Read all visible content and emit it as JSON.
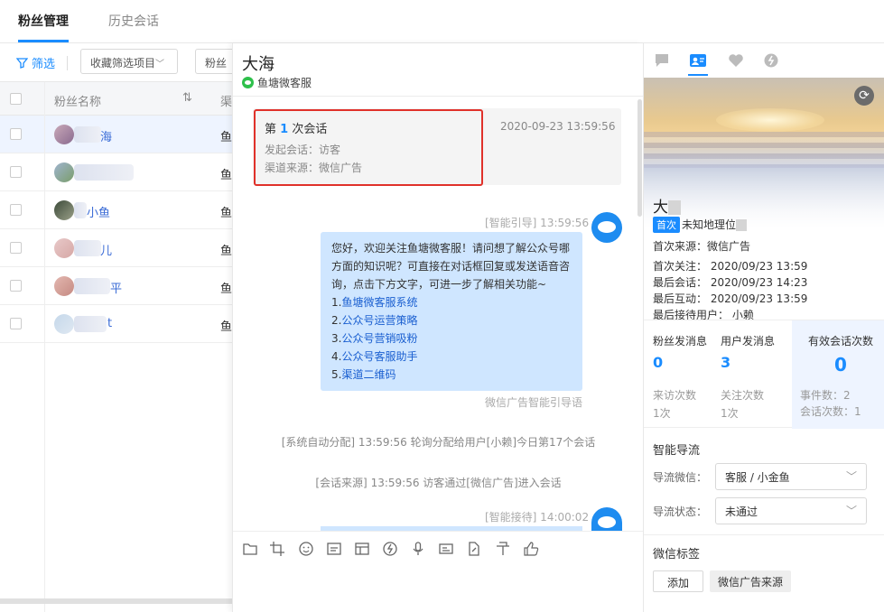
{
  "topbar": {
    "tabs": [
      {
        "label": "粉丝管理"
      },
      {
        "label": "历史会话"
      }
    ]
  },
  "left": {
    "filter_label": "筛选",
    "fav_filter_label": "收藏筛选项目",
    "partial_btn_label": "粉丝",
    "col_name": "粉丝名称",
    "col_channel": "渠",
    "rows": [
      {
        "name_visible": "海",
        "channel": "鱼"
      },
      {
        "name_visible": "",
        "channel": "鱼"
      },
      {
        "name_visible": "小鱼",
        "channel": "鱼"
      },
      {
        "name_visible": "儿",
        "channel": "鱼"
      },
      {
        "name_visible": "平",
        "channel": "鱼"
      },
      {
        "name_visible": "t",
        "channel": "鱼"
      }
    ]
  },
  "chat": {
    "title": "大海",
    "subtitle": "鱼塘微客服",
    "session": {
      "prefix": "第",
      "number": "1",
      "suffix": "次会话",
      "datetime": "2020-09-23 13:59:56",
      "initiator": "发起会话：访客",
      "source": "渠道来源：微信广告"
    },
    "msg1_meta": "[智能引导] 13:59:56",
    "msg1_intro": "您好，欢迎关注鱼塘微客服！请问想了解公众号哪方面的知识呢？可直接在对话框回复或发送语音咨询，点击下方文字，可进一步了解相关功能~",
    "msg1_links": [
      {
        "num": "1.",
        "text": "鱼塘微客服系统"
      },
      {
        "num": "2.",
        "text": "公众号运营策略"
      },
      {
        "num": "3.",
        "text": "公众号营销吸粉"
      },
      {
        "num": "4.",
        "text": "公众号客服助手"
      },
      {
        "num": "5.",
        "text": "渠道二维码"
      }
    ],
    "msg1_footer": "微信广告智能引导语",
    "sys1_tag": "[系统自动分配]",
    "sys1_text": "13:59:56 轮询分配给用户[小赖]今日第17个会话",
    "sys2_tag": "[会话来源]",
    "sys2_text": "13:59:56 访客通过[微信广告]进入会话",
    "msg2_meta": "[智能接待] 14:00:02",
    "toolbar_icons": [
      "folder-icon",
      "crop-icon",
      "emoji-icon",
      "doc-icon",
      "layout-icon",
      "coin-icon",
      "mic-icon",
      "card-icon",
      "share-icon",
      "umbrella-icon",
      "thumbs-up-icon"
    ]
  },
  "profile": {
    "name": "大",
    "badge": "首次",
    "location": "未知地理位",
    "first_source": "首次来源：微信广告",
    "first_follow": "首次关注： 2020/09/23 13:59",
    "last_session": "最后会话： 2020/09/23 14:23",
    "last_interact": "最后互动： 2020/09/23 13:59",
    "last_agent": "最后接待用户： 小赖",
    "stats": {
      "fan_msg_label": "粉丝发消息",
      "fan_msg_val": "0",
      "user_msg_label": "用户发消息",
      "user_msg_val": "3",
      "valid_label": "有效会话次数",
      "valid_val": "0",
      "visit": "来访次数",
      "visit_val": "1次",
      "follow": "关注次数",
      "follow_val": "1次",
      "events": "事件数：2",
      "sessions": "会话次数：1"
    },
    "guide_title": "智能导流",
    "guide_wechat_label": "导流微信：",
    "guide_wechat_val": "客服 / 小金鱼",
    "guide_status_label": "导流状态：",
    "guide_status_val": "未通过",
    "tags_title": "微信标签",
    "add_label": "添加",
    "tag1": "微信广告来源"
  },
  "colors": {
    "accent": "#1a8cff",
    "bubble": "#cfe6ff",
    "highlight_border": "#e0312a"
  }
}
